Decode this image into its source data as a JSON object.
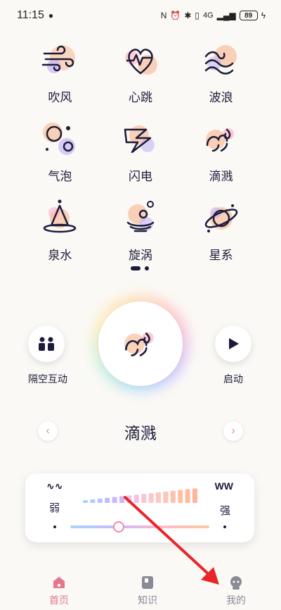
{
  "status": {
    "time": "11:15",
    "battery": "89",
    "network": "4G"
  },
  "grid": [
    {
      "label": "吹风",
      "icon": "wind-icon"
    },
    {
      "label": "心跳",
      "icon": "heartbeat-icon"
    },
    {
      "label": "波浪",
      "icon": "wave-icon"
    },
    {
      "label": "气泡",
      "icon": "bubbles-icon"
    },
    {
      "label": "闪电",
      "icon": "lightning-icon"
    },
    {
      "label": "滴溅",
      "icon": "splash-icon"
    },
    {
      "label": "泉水",
      "icon": "fountain-icon"
    },
    {
      "label": "旋涡",
      "icon": "vortex-icon"
    },
    {
      "label": "星系",
      "icon": "galaxy-icon"
    }
  ],
  "controls": {
    "left_label": "隔空互动",
    "right_label": "启动",
    "current_mode": "滴溅"
  },
  "intensity": {
    "low_label": "弱",
    "high_label": "强",
    "low_wave": "∿∿",
    "high_wave": "WW",
    "level": 0.35
  },
  "tabs": [
    {
      "label": "首页",
      "active": true
    },
    {
      "label": "知识",
      "active": false
    },
    {
      "label": "我的",
      "active": false
    }
  ],
  "colors": {
    "accent": "#e8758a",
    "ink": "#1c1c3a"
  }
}
